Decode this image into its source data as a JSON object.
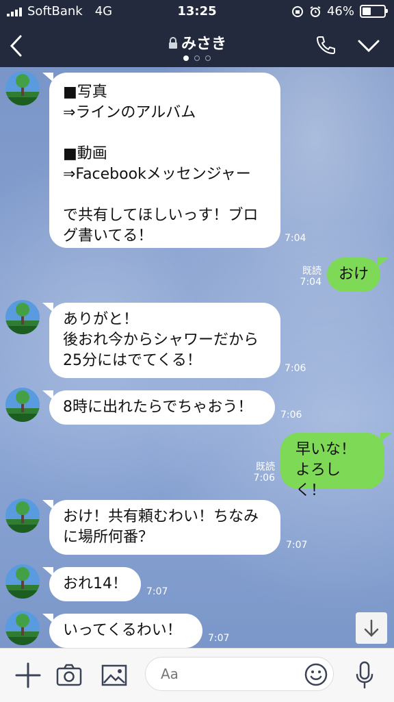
{
  "status_bar": {
    "carrier": "SoftBank",
    "network": "4G",
    "time": "13:25",
    "battery": "46%",
    "battery_level": 0.46
  },
  "header": {
    "title": "みさき",
    "page_dots": 3,
    "active_dot": 0
  },
  "messages": [
    {
      "side": "in",
      "lines": [
        "■写真",
        "⇒ラインのアルバム",
        "",
        "■動画",
        "⇒Facebookメッセンジャー",
        "",
        "で共有してほしいっす！ブロ",
        "グ書いてる！"
      ],
      "time": "7:04"
    },
    {
      "side": "out",
      "lines": [
        "おけ"
      ],
      "read": "既読",
      "time": "7:04"
    },
    {
      "side": "in",
      "lines": [
        "ありがと！",
        "後おれ今からシャワーだから",
        "25分にはでてくる！"
      ],
      "time": "7:06"
    },
    {
      "side": "in",
      "lines": [
        "8時に出れたらでちゃおう！"
      ],
      "time": "7:06"
    },
    {
      "side": "out",
      "lines": [
        "早いな！",
        "よろしく！"
      ],
      "read": "既読",
      "time": "7:06"
    },
    {
      "side": "in",
      "lines": [
        "おけ！共有頼むわい！ちなみ",
        "に場所何番？"
      ],
      "time": "7:07"
    },
    {
      "side": "in",
      "lines": [
        "おれ14！"
      ],
      "time": "7:07"
    },
    {
      "side": "in",
      "lines": [
        "いってくるわい！"
      ],
      "time": "7:07"
    }
  ],
  "input": {
    "placeholder": "Aa"
  },
  "icons": {
    "back": "chevron-left-icon",
    "lock": "lock-icon",
    "call": "phone-icon",
    "menu": "chevron-down-icon",
    "add": "plus-icon",
    "camera": "camera-icon",
    "image": "image-icon",
    "emoji": "smiley-icon",
    "mic": "mic-icon",
    "scroll": "arrow-down-icon"
  },
  "colors": {
    "header_bg": "#232a3d",
    "bubble_in": "#ffffff",
    "bubble_out": "#7ed957",
    "chat_bg": "#7f9ac9"
  }
}
